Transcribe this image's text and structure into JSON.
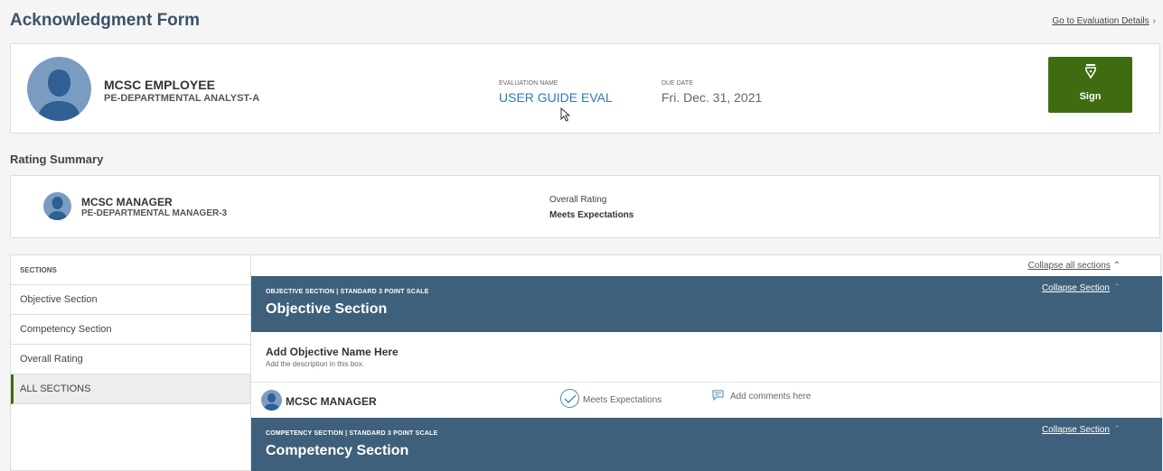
{
  "header": {
    "title": "Acknowledgment Form",
    "goto_link": "Go to Evaluation Details"
  },
  "employee": {
    "name": "MCSC EMPLOYEE",
    "title": "PE-DEPARTMENTAL ANALYST-A",
    "evaluation_name_label": "EVALUATION NAME",
    "evaluation_name": "USER GUIDE EVAL",
    "due_date_label": "DUE DATE",
    "due_date": "Fri. Dec. 31, 2021",
    "sign_label": "Sign"
  },
  "rating_summary": {
    "heading": "Rating Summary",
    "manager_name": "MCSC MANAGER",
    "manager_title": "PE-DEPARTMENTAL MANAGER-3",
    "overall_label": "Overall Rating",
    "overall_value": "Meets Expectations"
  },
  "sidebar": {
    "header": "SECTIONS",
    "items": [
      {
        "label": "Objective Section"
      },
      {
        "label": "Competency Section"
      },
      {
        "label": "Overall Rating"
      },
      {
        "label": "ALL SECTIONS"
      }
    ]
  },
  "main": {
    "collapse_all": "Collapse all sections",
    "objective": {
      "subtitle": "OBJECTIVE SECTION | STANDARD 3 POINT SCALE",
      "title": "Objective Section",
      "collapse": "Collapse Section",
      "item_name": "Add Objective Name Here",
      "item_desc": "Add the description in this box.",
      "rater": "MCSC MANAGER",
      "rating": "Meets Expectations",
      "comment_placeholder": "Add comments here"
    },
    "competency": {
      "subtitle": "COMPETENCY SECTION | STANDARD 3 POINT SCALE",
      "title": "Competency Section",
      "collapse": "Collapse Section"
    }
  },
  "colors": {
    "title_blue": "#39536b",
    "section_header": "#3e607a",
    "sign_green": "#3f6c11",
    "link_blue": "#2c7bb0",
    "avatar_blue": "#7b9cc1"
  }
}
